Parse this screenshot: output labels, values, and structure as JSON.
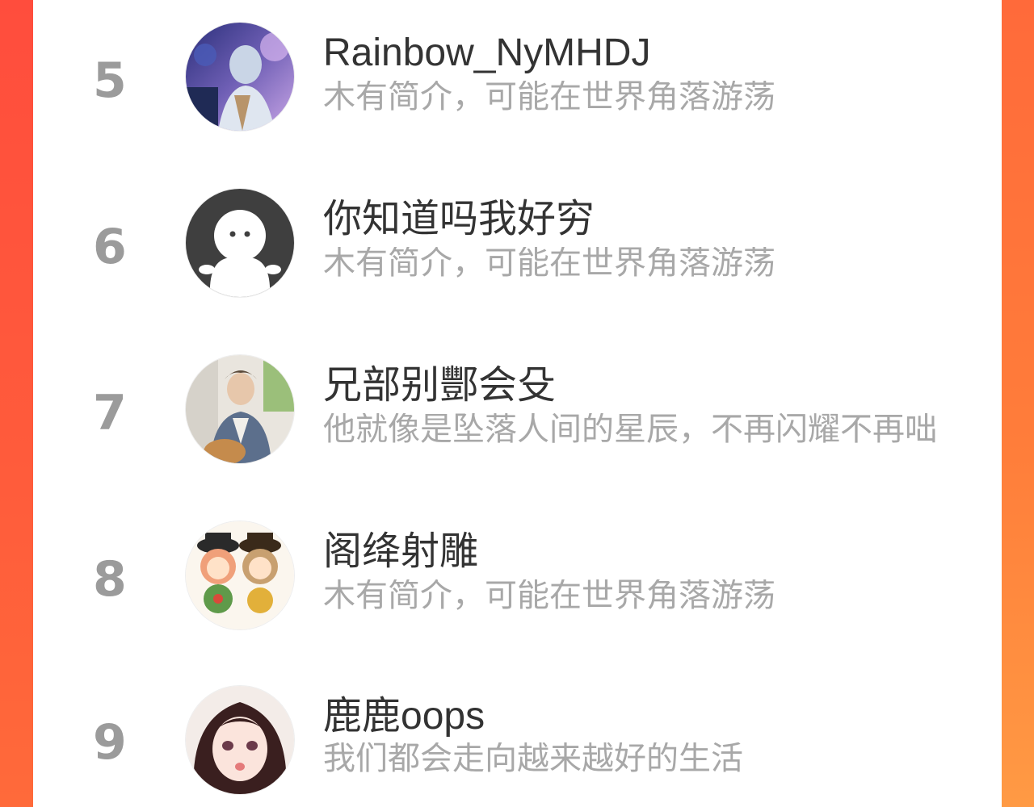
{
  "colors": {
    "accent_left": "#ff4d3d",
    "accent_right": "#ff8a3c",
    "rank_number": "#9b9b9b",
    "name_text": "#333333",
    "bio_text": "#a8a8a8"
  },
  "ranking": {
    "entries": [
      {
        "rank": "5",
        "name": "Rainbow_NyMHDJ",
        "bio": "木有简介，可能在世界角落游荡",
        "avatar_icon": "avatar-anime-monk"
      },
      {
        "rank": "6",
        "name": "你知道吗我好穷",
        "bio": "木有简介，可能在世界角落游荡",
        "avatar_icon": "avatar-default-ghost"
      },
      {
        "rank": "7",
        "name": "兄部别酆会殳",
        "bio": "他就像是坠落人间的星辰，不再闪耀不再咄",
        "avatar_icon": "avatar-guitar-man"
      },
      {
        "rank": "8",
        "name": "阁绛射雕",
        "bio": "木有简介，可能在世界角落游荡",
        "avatar_icon": "avatar-chibi-pair"
      },
      {
        "rank": "9",
        "name": "鹿鹿oops",
        "bio": "我们都会走向越来越好的生活",
        "avatar_icon": "avatar-anime-girl"
      }
    ]
  }
}
